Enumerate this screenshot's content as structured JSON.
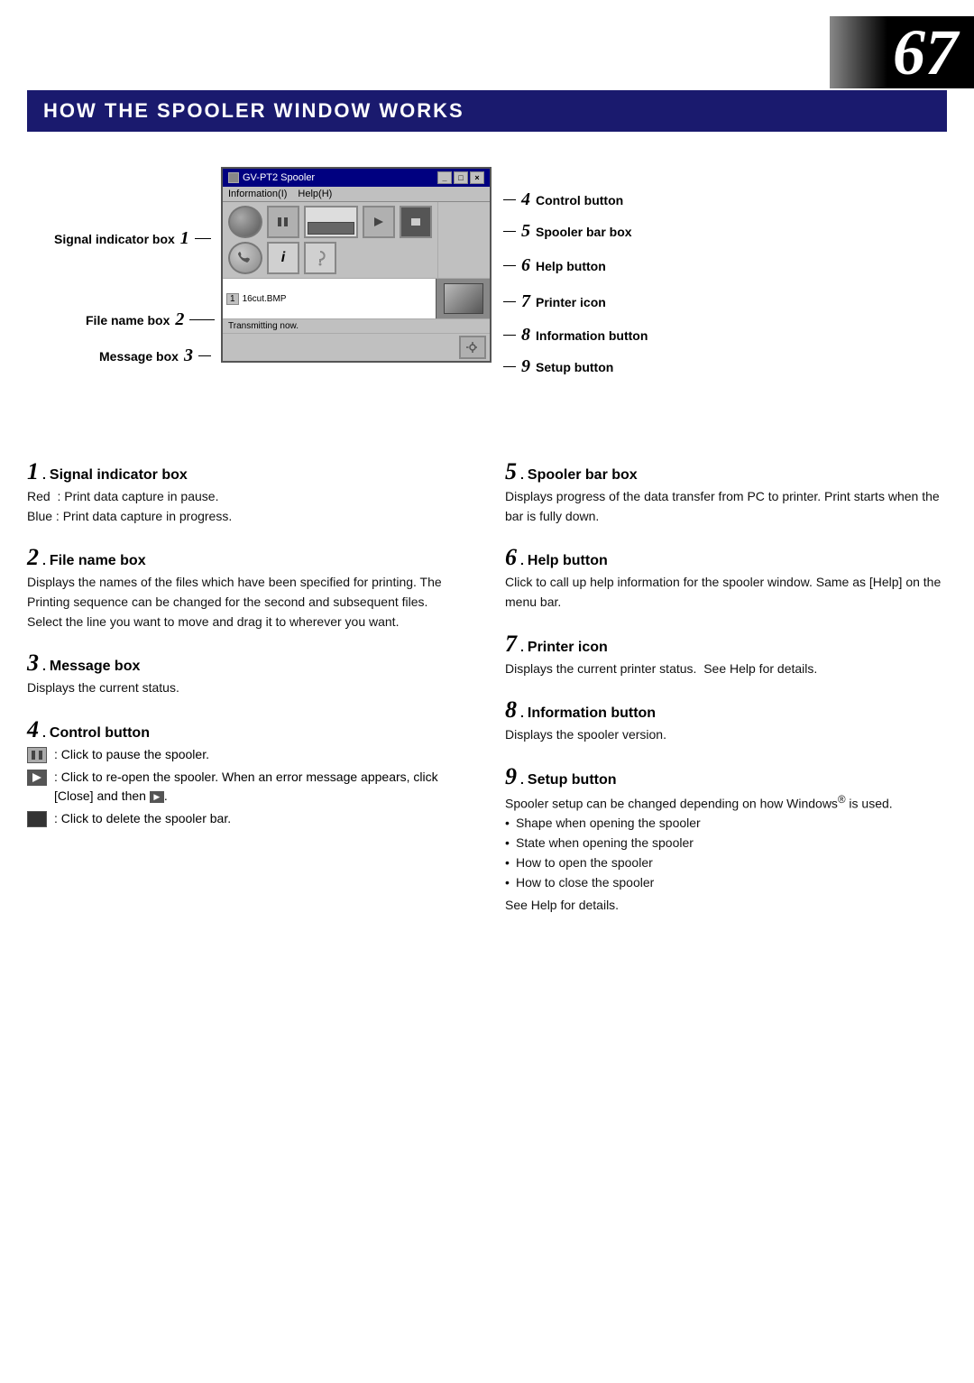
{
  "page": {
    "number": "67",
    "header": "HOW THE SPOOLER WINDOW WORKS"
  },
  "spooler_window": {
    "title": "GV-PT2 Spooler",
    "menu": [
      "Information(I)",
      "Help(H)"
    ],
    "titlebar_btns": [
      "-",
      "□",
      "×"
    ],
    "file_entry": "1   16cut.BMP",
    "message": "Transmitting now."
  },
  "diagram_labels": {
    "left": [
      {
        "num": "1",
        "label": "Signal indicator box"
      },
      {
        "num": "2",
        "label": "File name box"
      },
      {
        "num": "3",
        "label": "Message box"
      }
    ],
    "right": [
      {
        "num": "4",
        "label": "Control button"
      },
      {
        "num": "5",
        "label": "Spooler bar box"
      },
      {
        "num": "6",
        "label": "Help button"
      },
      {
        "num": "7",
        "label": "Printer icon"
      },
      {
        "num": "8",
        "label": "Information button"
      },
      {
        "num": "9",
        "label": "Setup button"
      }
    ]
  },
  "sections": {
    "left": [
      {
        "num": "1",
        "title": "Signal indicator box",
        "body": "Red  : Print data capture in pause.\nBlue : Print data capture in progress."
      },
      {
        "num": "2",
        "title": "File name box",
        "body": "Displays the names of the files which have been specified for printing. The Printing sequence can be changed for the second and subsequent files.  Select the line you want to move and drag it to wherever you want."
      },
      {
        "num": "3",
        "title": "Message box",
        "body": "Displays the current status."
      },
      {
        "num": "4",
        "title": "Control button",
        "subitems": [
          {
            "icon": "pause",
            "text": ": Click to pause the spooler."
          },
          {
            "icon": "play",
            "text": ": Click to re-open the spooler. When an error message appears, click [Close] and then"
          },
          {
            "icon": "delete",
            "text": ": Click to delete the spooler bar."
          }
        ]
      }
    ],
    "right": [
      {
        "num": "5",
        "title": "Spooler bar box",
        "body": "Displays progress of the data transfer from PC to printer. Print starts when the bar is fully down."
      },
      {
        "num": "6",
        "title": "Help button",
        "body": "Click to call up help information for the spooler window. Same as [Help] on the menu bar."
      },
      {
        "num": "7",
        "title": "Printer icon",
        "body": "Displays the current printer status.  See Help for details."
      },
      {
        "num": "8",
        "title": "Information button",
        "body": "Displays the spooler version."
      },
      {
        "num": "9",
        "title": "Setup button",
        "intro": "Spooler setup can be changed depending on how Windows® is used.",
        "bullets": [
          "Shape when opening the spooler",
          "State when opening the spooler",
          "How to open the spooler",
          "How to close the spooler"
        ],
        "footer": "See Help for details."
      }
    ]
  }
}
